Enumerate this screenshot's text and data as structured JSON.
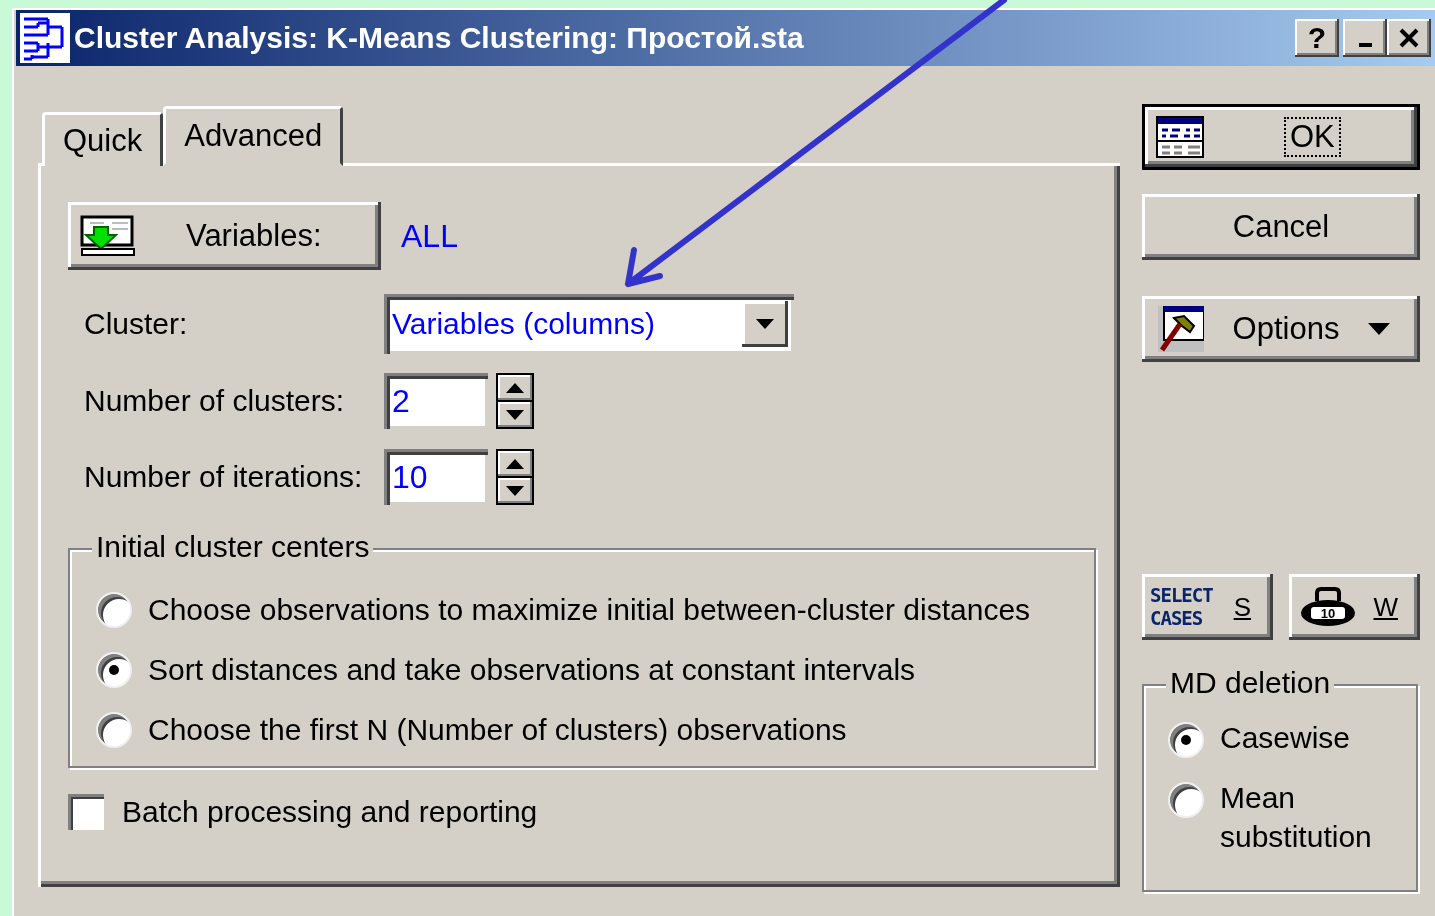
{
  "window": {
    "title": "Cluster Analysis: K-Means Clustering: Простой.sta",
    "title_buttons": [
      {
        "kind": "help",
        "label": "?"
      },
      {
        "kind": "minimize"
      },
      {
        "kind": "close"
      }
    ]
  },
  "tabs": [
    {
      "label": "Quick",
      "selected": false
    },
    {
      "label": "Advanced",
      "selected": true
    }
  ],
  "variables": {
    "button": "Variables:",
    "value": "ALL"
  },
  "cluster": {
    "label": "Cluster:",
    "value": "Variables (columns)"
  },
  "spinners": [
    {
      "label": "Number of clusters:",
      "value": "2"
    },
    {
      "label": "Number of iterations:",
      "value": "10"
    }
  ],
  "initial_centers": {
    "legend": "Initial cluster centers",
    "options": [
      {
        "label": "Choose observations to maximize initial between-cluster distances",
        "selected": false
      },
      {
        "label": "Sort distances and take observations at constant intervals",
        "selected": true
      },
      {
        "label": "Choose the first N (Number of clusters) observations",
        "selected": false
      }
    ]
  },
  "batch": {
    "label": "Batch processing and reporting",
    "checked": false
  },
  "ok_button": {
    "label": "OK"
  },
  "cancel_button": {
    "label": "Cancel"
  },
  "options_button": {
    "label": "Options"
  },
  "select_cases": {
    "lines": [
      "SELECT",
      "CASES"
    ],
    "key": "S"
  },
  "weight": {
    "icon_label": "10",
    "key": "W"
  },
  "md_deletion": {
    "legend": "MD deletion",
    "options": [
      {
        "label": "Casewise",
        "selected": true
      },
      {
        "label": "Mean substitution",
        "selected": false
      }
    ]
  }
}
